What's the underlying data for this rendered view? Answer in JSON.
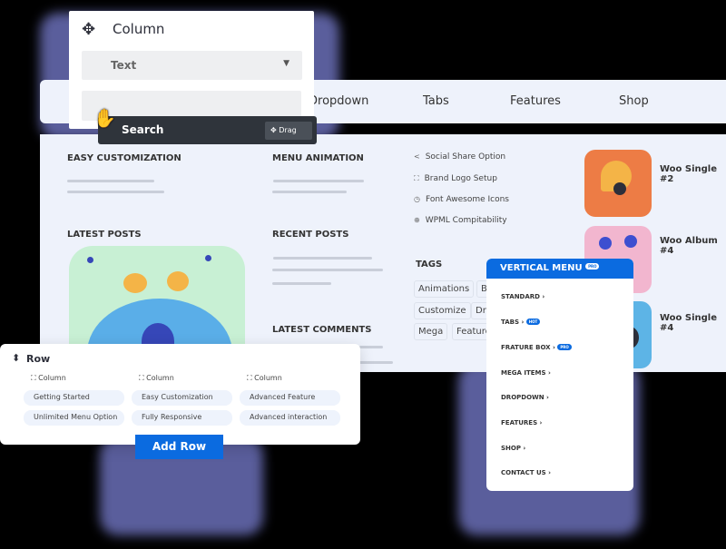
{
  "column_panel": {
    "title": "Column",
    "select_value": "Text",
    "input_value": ""
  },
  "search_bar": {
    "label": "Search",
    "drag_label": "Drag"
  },
  "nav": {
    "items": [
      "Dropdown",
      "Tabs",
      "Features",
      "Shop"
    ]
  },
  "main": {
    "easy_customization": "EASY CUSTOMIZATION",
    "menu_animation": "MENU ANIMATION",
    "latest_posts": "LATEST POSTS",
    "recent_posts": "RECENT POSTS",
    "latest_comments": "LATEST COMMENTS",
    "features": [
      "Social Share Option",
      "Brand Logo Setup",
      "Font Awesome Icons",
      "WPML Compitability"
    ],
    "tags_title": "TAGS",
    "tags": [
      "Animations",
      "B",
      "Customize",
      "Dro",
      "Mega",
      "Feature"
    ],
    "products": [
      "Woo Single #2",
      "Woo Album #4",
      "Woo Single #4"
    ]
  },
  "vertical_menu": {
    "title": "VERTICAL MENU",
    "title_badge": "PRO",
    "items": [
      {
        "label": "STANDARD"
      },
      {
        "label": "TABS",
        "badge": "HOT"
      },
      {
        "label": "FRATURE BOX",
        "badge": "PRO"
      },
      {
        "label": "MEGA ITEMS"
      },
      {
        "label": "DROPDOWN"
      },
      {
        "label": "FEATURES"
      },
      {
        "label": "SHOP"
      },
      {
        "label": "CONTACT US"
      }
    ]
  },
  "row_panel": {
    "title": "Row",
    "column_label": "Column",
    "pills": [
      "Getting Started",
      "Easy Customization",
      "Advanced Feature",
      "Unlimited Menu Option",
      "Fully Responsive",
      "Advanced interaction"
    ],
    "add_row": "Add Row"
  },
  "colors": {
    "accent": "#0b6be0",
    "panel_bg": "#eef2fb",
    "dark_bar": "#2f343b"
  }
}
